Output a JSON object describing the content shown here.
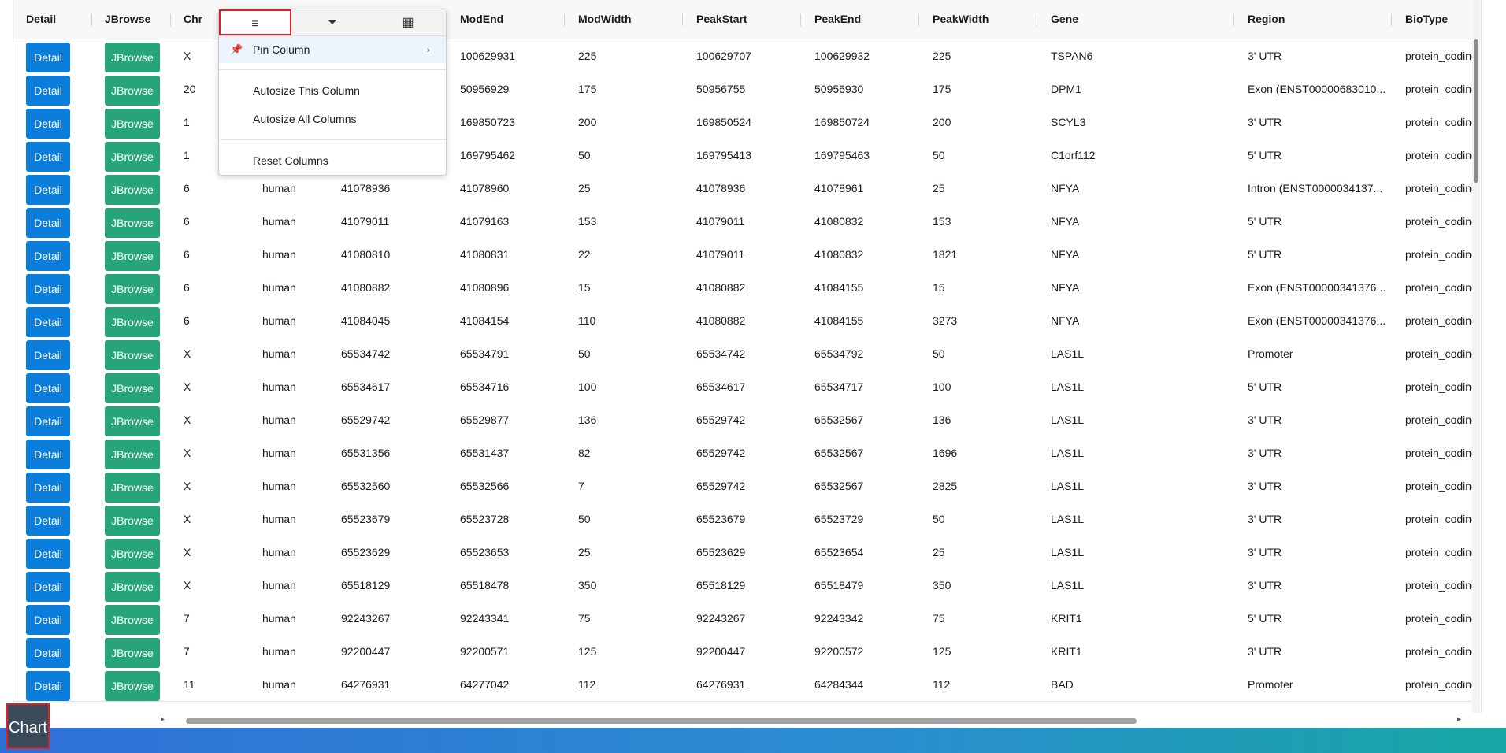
{
  "columns": [
    "Detail",
    "JBrowse",
    "Chr",
    "",
    "",
    "ModEnd",
    "ModWidth",
    "PeakStart",
    "PeakEnd",
    "PeakWidth",
    "Gene",
    "Region",
    "BioType"
  ],
  "rows": [
    {
      "chr": "X",
      "species": "",
      "modstart": "",
      "modend": "100629931",
      "modwidth": "225",
      "peakstart": "100629707",
      "peakend": "100629932",
      "peakwidth": "225",
      "gene": "TSPAN6",
      "region": "3' UTR",
      "biotype": "protein_coding"
    },
    {
      "chr": "20",
      "species": "",
      "modstart": "",
      "modend": "50956929",
      "modwidth": "175",
      "peakstart": "50956755",
      "peakend": "50956930",
      "peakwidth": "175",
      "gene": "DPM1",
      "region": "Exon (ENST00000683010...",
      "biotype": "protein_coding"
    },
    {
      "chr": "1",
      "species": "",
      "modstart": "",
      "modend": "169850723",
      "modwidth": "200",
      "peakstart": "169850524",
      "peakend": "169850724",
      "peakwidth": "200",
      "gene": "SCYL3",
      "region": "3' UTR",
      "biotype": "protein_coding"
    },
    {
      "chr": "1",
      "species": "",
      "modstart": "",
      "modend": "169795462",
      "modwidth": "50",
      "peakstart": "169795413",
      "peakend": "169795463",
      "peakwidth": "50",
      "gene": "C1orf112",
      "region": "5' UTR",
      "biotype": "protein_coding"
    },
    {
      "chr": "6",
      "species": "human",
      "modstart": "41078936",
      "modend": "41078960",
      "modwidth": "25",
      "peakstart": "41078936",
      "peakend": "41078961",
      "peakwidth": "25",
      "gene": "NFYA",
      "region": "Intron (ENST0000034137...",
      "biotype": "protein_coding"
    },
    {
      "chr": "6",
      "species": "human",
      "modstart": "41079011",
      "modend": "41079163",
      "modwidth": "153",
      "peakstart": "41079011",
      "peakend": "41080832",
      "peakwidth": "153",
      "gene": "NFYA",
      "region": "5' UTR",
      "biotype": "protein_coding"
    },
    {
      "chr": "6",
      "species": "human",
      "modstart": "41080810",
      "modend": "41080831",
      "modwidth": "22",
      "peakstart": "41079011",
      "peakend": "41080832",
      "peakwidth": "1821",
      "gene": "NFYA",
      "region": "5' UTR",
      "biotype": "protein_coding"
    },
    {
      "chr": "6",
      "species": "human",
      "modstart": "41080882",
      "modend": "41080896",
      "modwidth": "15",
      "peakstart": "41080882",
      "peakend": "41084155",
      "peakwidth": "15",
      "gene": "NFYA",
      "region": "Exon (ENST00000341376...",
      "biotype": "protein_coding"
    },
    {
      "chr": "6",
      "species": "human",
      "modstart": "41084045",
      "modend": "41084154",
      "modwidth": "110",
      "peakstart": "41080882",
      "peakend": "41084155",
      "peakwidth": "3273",
      "gene": "NFYA",
      "region": "Exon (ENST00000341376...",
      "biotype": "protein_coding"
    },
    {
      "chr": "X",
      "species": "human",
      "modstart": "65534742",
      "modend": "65534791",
      "modwidth": "50",
      "peakstart": "65534742",
      "peakend": "65534792",
      "peakwidth": "50",
      "gene": "LAS1L",
      "region": "Promoter",
      "biotype": "protein_coding"
    },
    {
      "chr": "X",
      "species": "human",
      "modstart": "65534617",
      "modend": "65534716",
      "modwidth": "100",
      "peakstart": "65534617",
      "peakend": "65534717",
      "peakwidth": "100",
      "gene": "LAS1L",
      "region": "5' UTR",
      "biotype": "protein_coding"
    },
    {
      "chr": "X",
      "species": "human",
      "modstart": "65529742",
      "modend": "65529877",
      "modwidth": "136",
      "peakstart": "65529742",
      "peakend": "65532567",
      "peakwidth": "136",
      "gene": "LAS1L",
      "region": "3' UTR",
      "biotype": "protein_coding"
    },
    {
      "chr": "X",
      "species": "human",
      "modstart": "65531356",
      "modend": "65531437",
      "modwidth": "82",
      "peakstart": "65529742",
      "peakend": "65532567",
      "peakwidth": "1696",
      "gene": "LAS1L",
      "region": "3' UTR",
      "biotype": "protein_coding"
    },
    {
      "chr": "X",
      "species": "human",
      "modstart": "65532560",
      "modend": "65532566",
      "modwidth": "7",
      "peakstart": "65529742",
      "peakend": "65532567",
      "peakwidth": "2825",
      "gene": "LAS1L",
      "region": "3' UTR",
      "biotype": "protein_coding"
    },
    {
      "chr": "X",
      "species": "human",
      "modstart": "65523679",
      "modend": "65523728",
      "modwidth": "50",
      "peakstart": "65523679",
      "peakend": "65523729",
      "peakwidth": "50",
      "gene": "LAS1L",
      "region": "3' UTR",
      "biotype": "protein_coding"
    },
    {
      "chr": "X",
      "species": "human",
      "modstart": "65523629",
      "modend": "65523653",
      "modwidth": "25",
      "peakstart": "65523629",
      "peakend": "65523654",
      "peakwidth": "25",
      "gene": "LAS1L",
      "region": "3' UTR",
      "biotype": "protein_coding"
    },
    {
      "chr": "X",
      "species": "human",
      "modstart": "65518129",
      "modend": "65518478",
      "modwidth": "350",
      "peakstart": "65518129",
      "peakend": "65518479",
      "peakwidth": "350",
      "gene": "LAS1L",
      "region": "3' UTR",
      "biotype": "protein_coding"
    },
    {
      "chr": "7",
      "species": "human",
      "modstart": "92243267",
      "modend": "92243341",
      "modwidth": "75",
      "peakstart": "92243267",
      "peakend": "92243342",
      "peakwidth": "75",
      "gene": "KRIT1",
      "region": "5' UTR",
      "biotype": "protein_coding"
    },
    {
      "chr": "7",
      "species": "human",
      "modstart": "92200447",
      "modend": "92200571",
      "modwidth": "125",
      "peakstart": "92200447",
      "peakend": "92200572",
      "peakwidth": "125",
      "gene": "KRIT1",
      "region": "3' UTR",
      "biotype": "protein_coding"
    },
    {
      "chr": "11",
      "species": "human",
      "modstart": "64276931",
      "modend": "64277042",
      "modwidth": "112",
      "peakstart": "64276931",
      "peakend": "64284344",
      "peakwidth": "112",
      "gene": "BAD",
      "region": "Promoter",
      "biotype": "protein_coding"
    }
  ],
  "buttons": {
    "detail": "Detail",
    "jbrowse": "JBrowse",
    "chart": "Chart"
  },
  "column_menu": {
    "tabs": [
      {
        "icon": "menu-icon",
        "glyph": "≡"
      },
      {
        "icon": "filter-icon",
        "glyph": "⏷"
      },
      {
        "icon": "columns-icon",
        "glyph": "▦"
      }
    ],
    "items": [
      "Pin Column",
      "Autosize This Column",
      "Autosize All Columns",
      "Reset Columns"
    ]
  },
  "colors": {
    "detail": "#0b7dda",
    "jbrowse": "#27a579",
    "highlight": "#e02020"
  }
}
